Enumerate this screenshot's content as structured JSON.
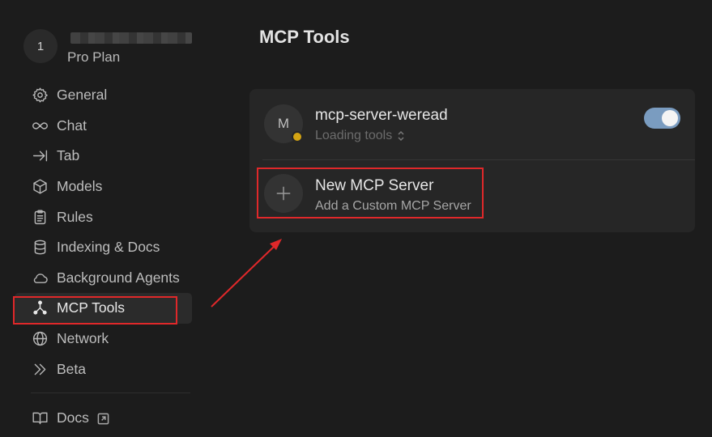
{
  "profile": {
    "avatar_initial": "1",
    "plan": "Pro Plan"
  },
  "sidebar": {
    "items": [
      {
        "label": "General",
        "icon": "gear-icon"
      },
      {
        "label": "Chat",
        "icon": "infinity-icon"
      },
      {
        "label": "Tab",
        "icon": "arrow-to-line-icon"
      },
      {
        "label": "Models",
        "icon": "cube-icon"
      },
      {
        "label": "Rules",
        "icon": "clipboard-icon"
      },
      {
        "label": "Indexing & Docs",
        "icon": "database-icon"
      },
      {
        "label": "Background Agents",
        "icon": "cloud-icon"
      },
      {
        "label": "MCP Tools",
        "icon": "mcp-nodes-icon",
        "active": true
      },
      {
        "label": "Network",
        "icon": "globe-icon"
      },
      {
        "label": "Beta",
        "icon": "double-chevron-right-icon"
      }
    ],
    "docs_label": "Docs"
  },
  "main": {
    "title": "MCP Tools",
    "server": {
      "avatar_initial": "M",
      "name": "mcp-server-weread",
      "status": "Loading tools",
      "enabled": true,
      "status_color": "#d4a413"
    },
    "new_server": {
      "title": "New MCP Server",
      "subtitle": "Add a Custom MCP Server"
    }
  },
  "colors": {
    "background": "#1c1c1c",
    "card": "#262626",
    "toggle_on": "#7a9cc0",
    "annotation": "#e0282a"
  }
}
